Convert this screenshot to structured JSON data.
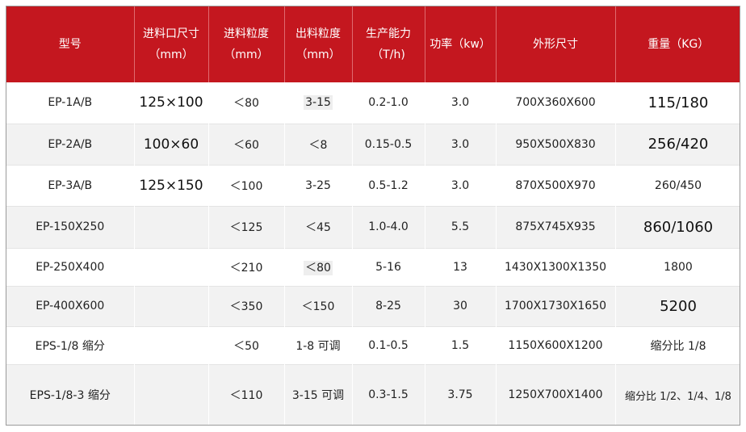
{
  "headers": [
    {
      "line1": "型号",
      "line2": ""
    },
    {
      "line1": "进料口尺寸",
      "line2": "（mm）"
    },
    {
      "line1": "进料粒度",
      "line2": "（mm）"
    },
    {
      "line1": "出料粒度",
      "line2": "（mm）"
    },
    {
      "line1": "生产能力",
      "line2": "（T/h)"
    },
    {
      "line1": "功率（kw）",
      "line2": ""
    },
    {
      "line1": "外形尺寸",
      "line2": ""
    },
    {
      "line1": "重量（KG）",
      "line2": ""
    }
  ],
  "rows": [
    {
      "model": "EP-1A/B",
      "inlet": "125×100",
      "feed": "＜80",
      "output": "3-15",
      "capacity": "0.2-1.0",
      "power": "3.0",
      "dims": "700X360X600",
      "weight": "115/180"
    },
    {
      "model": "EP-2A/B",
      "inlet": "100×60",
      "feed": "＜60",
      "output": "＜8",
      "capacity": "0.15-0.5",
      "power": "3.0",
      "dims": "950X500X830",
      "weight": "256/420"
    },
    {
      "model": "EP-3A/B",
      "inlet": "125×150",
      "feed": "＜100",
      "output": "3-25",
      "capacity": "0.5-1.2",
      "power": "3.0",
      "dims": "870X500X970",
      "weight": "260/450"
    },
    {
      "model": "EP-150X250",
      "inlet": "",
      "feed": "＜125",
      "output": "＜45",
      "capacity": "1.0-4.0",
      "power": "5.5",
      "dims": "875X745X935",
      "weight": "860/1060"
    },
    {
      "model": "EP-250X400",
      "inlet": "",
      "feed": "＜210",
      "output": "＜80",
      "capacity": "5-16",
      "power": "13",
      "dims": "1430X1300X1350",
      "weight": "1800"
    },
    {
      "model": "EP-400X600",
      "inlet": "",
      "feed": "＜350",
      "output": "＜150",
      "capacity": "8-25",
      "power": "30",
      "dims": "1700X1730X1650",
      "weight": "5200"
    },
    {
      "model": "EPS-1/8 缩分",
      "inlet": "",
      "feed": "＜50",
      "output": "1-8 可调",
      "capacity": "0.1-0.5",
      "power": "1.5",
      "dims": "1150X600X1200",
      "weight": "缩分比 1/8"
    },
    {
      "model": "EPS-1/8-3 缩分",
      "inlet": "",
      "feed": "＜110",
      "output": "3-15 可调",
      "capacity": "0.3-1.5",
      "power": "3.75",
      "dims": "1250X700X1400",
      "weight": "缩分比 1/2、1/4、1/8"
    }
  ]
}
